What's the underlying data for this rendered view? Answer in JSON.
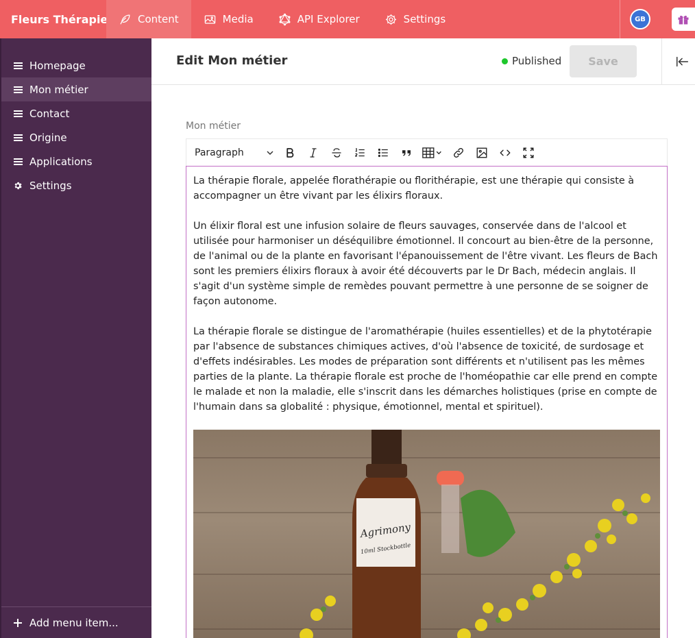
{
  "app": {
    "brand": "Fleurs Thérapie"
  },
  "topnav": {
    "items": [
      {
        "label": "Content",
        "icon": "feather-icon",
        "active": true
      },
      {
        "label": "Media",
        "icon": "image-icon",
        "active": false
      },
      {
        "label": "API Explorer",
        "icon": "graphql-icon",
        "active": false
      },
      {
        "label": "Settings",
        "icon": "gear-icon",
        "active": false
      }
    ],
    "avatar_initials": "GB"
  },
  "sidebar": {
    "items": [
      {
        "label": "Homepage",
        "icon": "list-icon"
      },
      {
        "label": "Mon métier",
        "icon": "list-icon",
        "active": true
      },
      {
        "label": "Contact",
        "icon": "list-icon"
      },
      {
        "label": "Origine",
        "icon": "list-icon"
      },
      {
        "label": "Applications",
        "icon": "list-icon"
      },
      {
        "label": "Settings",
        "icon": "gear-icon"
      }
    ],
    "footer_label": "Add menu item..."
  },
  "header": {
    "title": "Edit Mon métier",
    "status": "Published",
    "status_color": "#1ec72c",
    "save_label": "Save"
  },
  "field": {
    "label": "Mon métier",
    "block_format": "Paragraph",
    "paragraphs": [
      "La thérapie florale, appelée florathérapie ou florithérapie, est une thérapie qui consiste à accompagner un être vivant par les élixirs floraux.",
      "Un élixir floral est une infusion solaire de fleurs sauvages, conservée dans de l'alcool et utilisée pour harmoniser un déséquilibre émotionnel. Il concourt au bien-être de la personne, de l'animal ou de la plante en favorisant l'épanouissement de l'être vivant. Les fleurs de Bach sont les premiers élixirs floraux à avoir été découverts par le Dr Bach, médecin anglais. Il s'agit d'un système simple de remèdes pouvant permettre à une personne de se soigner de façon autonome.",
      "La thérapie florale se distingue de l'aromathérapie (huiles essentielles) et de la phytotérapie par l'absence de substances chimiques actives, d'où l'absence de toxicité, de surdosage et d'effets indésirables. Les modes de préparation sont différents et n'utilisent pas les mêmes parties de la plante. La thérapie florale est proche de l'homéopathie car elle prend en compte le malade et non la maladie, elle s'inscrit dans les démarches holistiques (prise en compte de l'humain dans sa globalité : physique, émotionnel, mental et spirituel)."
    ],
    "image_label_line1": "Agrimony",
    "image_label_line2": "10ml Stockbottle"
  },
  "colors": {
    "topbar": "#ef5f62",
    "sidebar": "#4b2a4d",
    "editor_border": "#c26fc6"
  }
}
